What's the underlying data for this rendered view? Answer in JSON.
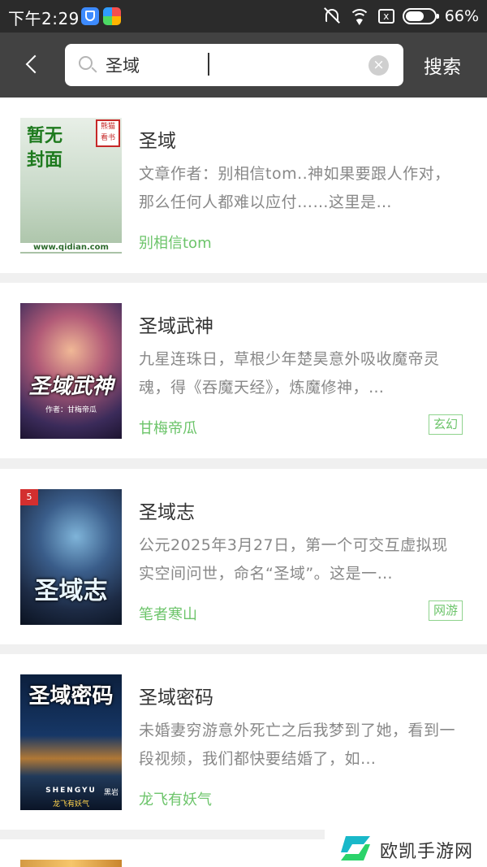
{
  "status_bar": {
    "time": "下午2:29",
    "sim_icon_label": "x",
    "battery_percent": "66%",
    "battery_level": 0.66
  },
  "search": {
    "query": "圣域",
    "button_label": "搜索"
  },
  "books": [
    {
      "title": "圣域",
      "description": "文章作者：别相信tom..神如果要跟人作对，那么任何人都难以应付……这里是…",
      "author": "别相信tom",
      "tag": "",
      "cover": {
        "title": "暂无封面",
        "badge": "熊猫看书",
        "footer": "www.qidian.com"
      }
    },
    {
      "title": "圣域武神",
      "description": "九星连珠日，草根少年楚昊意外吸收魔帝灵魂，得《吞魔天经》，炼魔修神，…",
      "author": "甘梅帝瓜",
      "tag": "玄幻",
      "cover": {
        "title": "圣域武神",
        "subtitle": "作者：甘梅帝瓜"
      }
    },
    {
      "title": "圣域志",
      "description": "公元2025年3月27日，第一个可交互虚拟现实空间问世，命名“圣域”。这是一…",
      "author": "笔者寒山",
      "tag": "网游",
      "cover": {
        "title": "圣域志",
        "badge": "5"
      }
    },
    {
      "title": "圣域密码",
      "description": "未婚妻穷游意外死亡之后我梦到了她，看到一段视频，我们都快要结婚了，如…",
      "author": "龙飞有妖气",
      "tag": "",
      "cover": {
        "title": "圣域密码",
        "subtitle": "SHENGYU",
        "footer": "龙飞有妖气",
        "badge": "黑岩"
      }
    }
  ],
  "watermark": {
    "text": "欧凯手游网"
  },
  "colors": {
    "accent_green": "#6cc46a",
    "header_bg": "#424242",
    "status_bg": "#2b2b2b"
  }
}
